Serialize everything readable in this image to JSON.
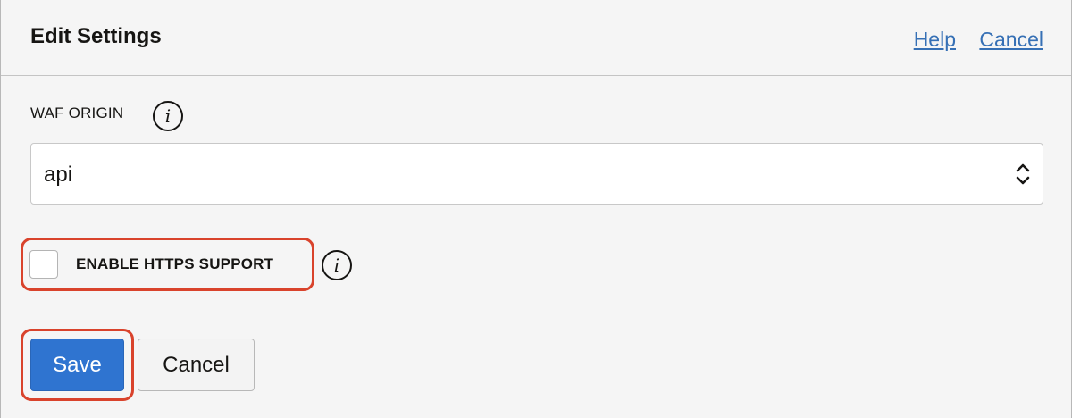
{
  "header": {
    "title": "Edit Settings",
    "help_label": "Help",
    "cancel_label": "Cancel"
  },
  "waf_origin": {
    "label": "WAF ORIGIN",
    "selected_value": "api",
    "info_icon": "info-icon"
  },
  "https": {
    "label": "ENABLE HTTPS SUPPORT",
    "checked": false,
    "info_icon": "info-icon"
  },
  "actions": {
    "save_label": "Save",
    "cancel_label": "Cancel"
  },
  "colors": {
    "link": "#3670b5",
    "primary": "#2f74d0",
    "highlight": "#d9432c"
  }
}
